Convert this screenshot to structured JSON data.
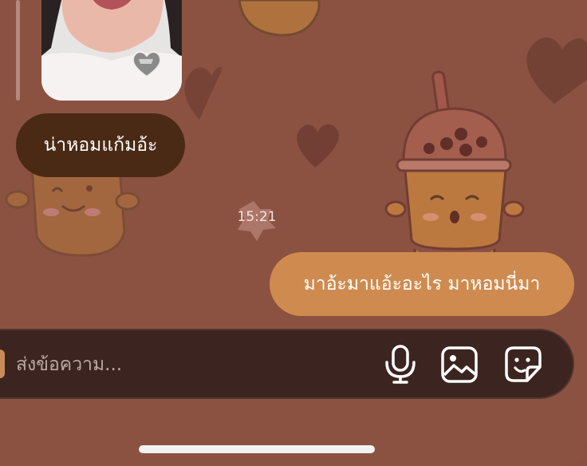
{
  "chat": {
    "messages": [
      {
        "direction": "incoming",
        "type": "text",
        "text": "น่าหอมแก้มอ้ะ"
      },
      {
        "direction": "outgoing",
        "type": "text",
        "text": "มาอ้ะมาแอ้ะอะไร มาหอมนี่มา"
      }
    ],
    "timestamp": "15:21"
  },
  "composer": {
    "placeholder": "ส่งข้อความ..."
  },
  "icons": {
    "mic": "microphone-icon",
    "gallery": "image-gallery-icon",
    "sticker": "sticker-icon",
    "reaction": "heart-reaction-icon"
  },
  "colors": {
    "background": "#8b5242",
    "incoming_bubble": "#4a2a14",
    "outgoing_bubble": "#cf8b4f",
    "composer": "#3c2520"
  }
}
